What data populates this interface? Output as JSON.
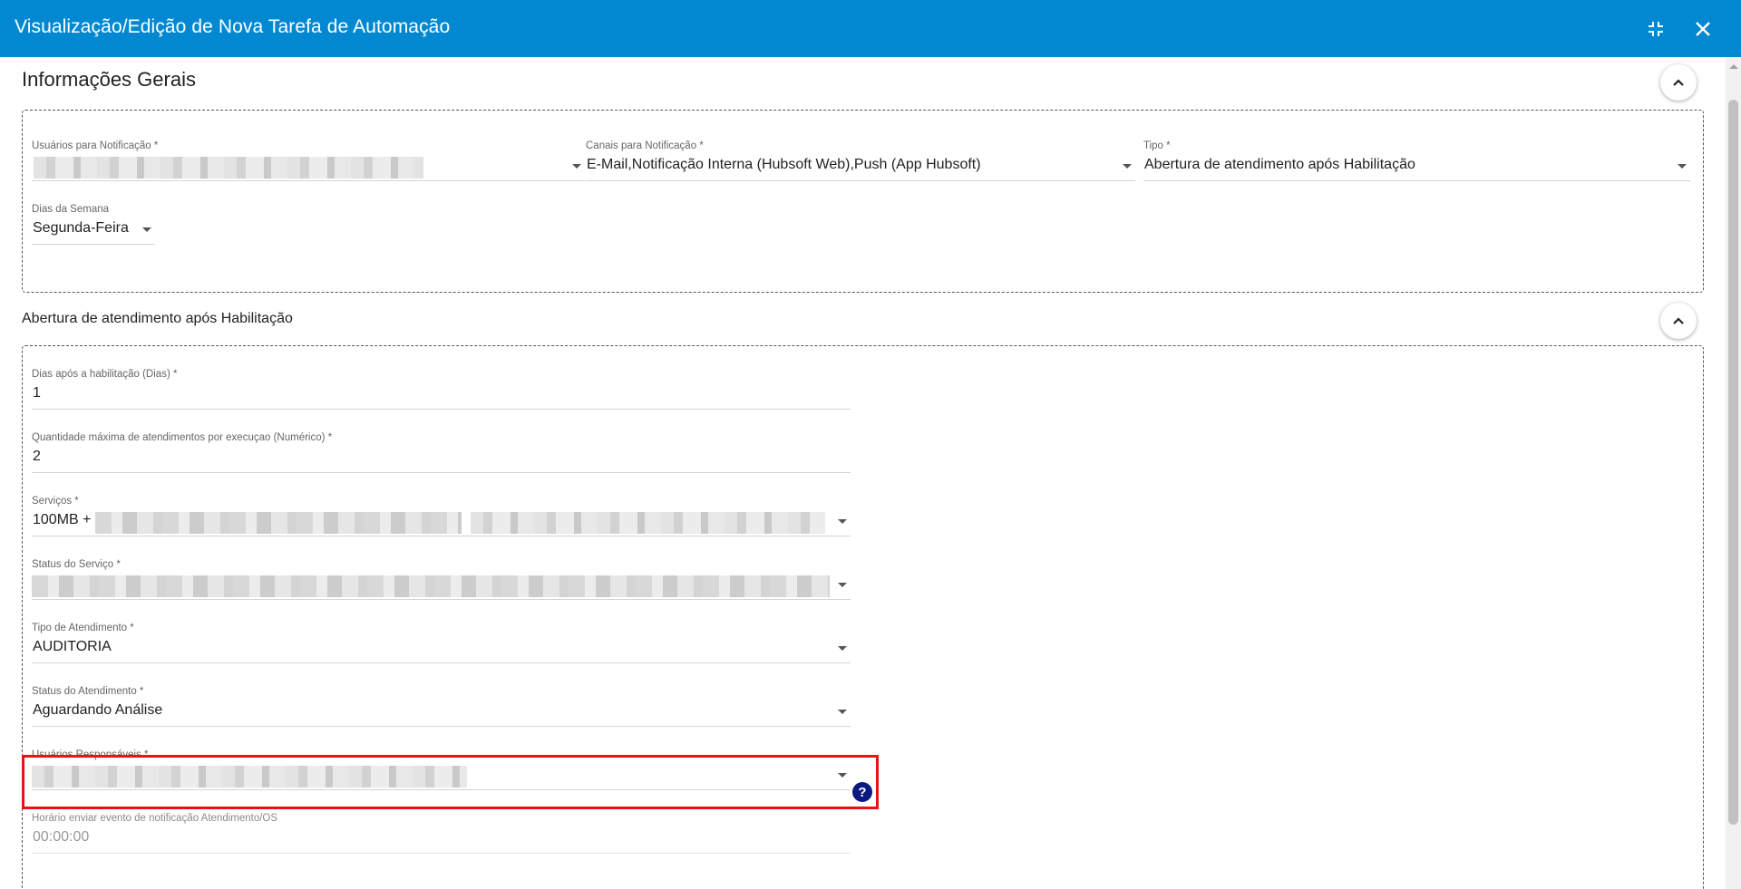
{
  "window": {
    "title": "Visualização/Edição de Nova Tarefa de Automação",
    "minimize_icon": "compress-icon",
    "close_icon": "close-icon"
  },
  "general": {
    "title": "Informações Gerais",
    "fields": {
      "users_label": "Usuários para Notificação *",
      "channels_label": "Canais para Notificação *",
      "channels_value": "E-Mail,Notificação Interna (Hubsoft Web),Push (App Hubsoft)",
      "type_label": "Tipo *",
      "type_value": "Abertura de atendimento após Habilitação",
      "weekdays_label": "Dias da Semana",
      "weekdays_value": "Segunda-Feira"
    }
  },
  "automation": {
    "title": "Abertura de atendimento após Habilitação",
    "fields": {
      "days_label": "Dias após a habilitação (Dias) *",
      "days_value": "1",
      "max_label": "Quantidade máxima de atendimentos por execuçao (Numérico) *",
      "max_value": "2",
      "services_label": "Serviços *",
      "services_value": "100MB +",
      "service_status_label": "Status do Serviço *",
      "ticket_type_label": "Tipo de Atendimento *",
      "ticket_type_value": "AUDITORIA",
      "ticket_status_label": "Status do Atendimento *",
      "ticket_status_value": "Aguardando Análise",
      "responsible_label": "Usuários Responsáveis *",
      "time_label": "Horário enviar evento de notificação Atendimento/OS",
      "time_placeholder": "00:00:00",
      "help_glyph": "?"
    }
  },
  "colors": {
    "header": "#0288d1",
    "highlight": "#ee1111",
    "help_icon": "#0c1a80"
  }
}
